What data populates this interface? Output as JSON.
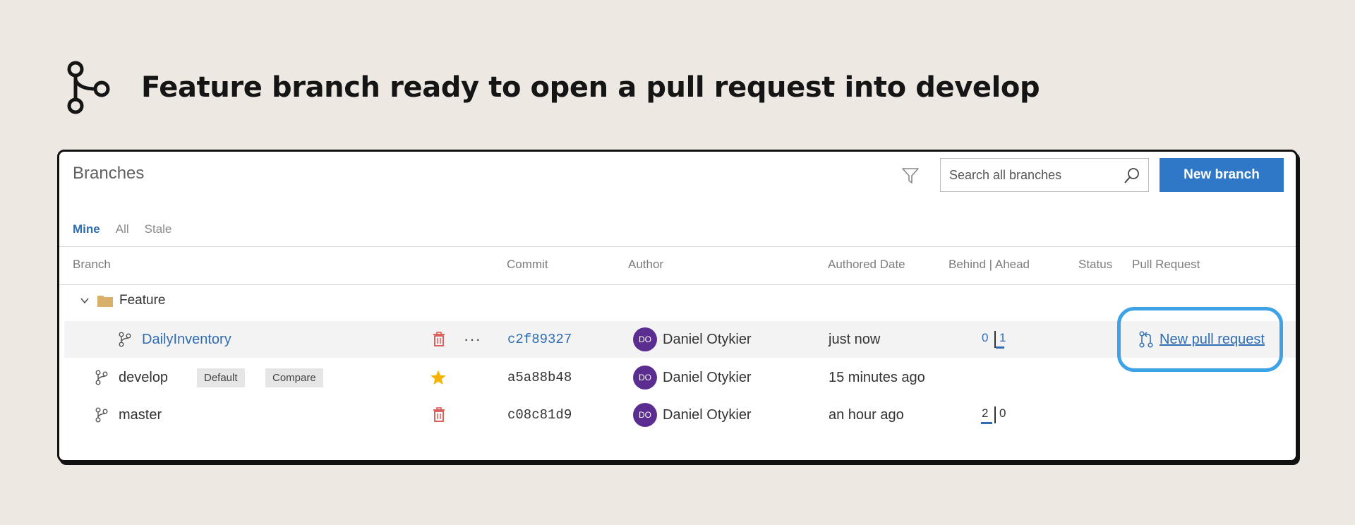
{
  "caption": {
    "title": "Feature branch ready to open a pull request into develop",
    "icon": "git-branch-icon"
  },
  "panel": {
    "title": "Branches",
    "search_placeholder": "Search all branches",
    "new_branch_label": "New branch",
    "tabs": [
      {
        "label": "Mine",
        "active": true
      },
      {
        "label": "All",
        "active": false
      },
      {
        "label": "Stale",
        "active": false
      }
    ],
    "columns": {
      "branch": "Branch",
      "commit": "Commit",
      "author": "Author",
      "authored_date": "Authored Date",
      "behind_ahead": "Behind | Ahead",
      "status": "Status",
      "pull_request": "Pull Request"
    },
    "group": {
      "label": "Feature",
      "expanded": true,
      "icon": "folder-icon"
    },
    "rows": [
      {
        "name": "DailyInventory",
        "commit": "c2f89327",
        "author_initials": "DO",
        "author": "Daniel Otykier",
        "date": "just now",
        "behind": "0",
        "ahead": "1",
        "behind_fraction": 0,
        "ahead_fraction": 1,
        "pull_request": "New pull request",
        "action_icon": "trash-icon",
        "highlighted": true
      },
      {
        "name": "develop",
        "badges": [
          "Default",
          "Compare"
        ],
        "commit": "a5a88b48",
        "author_initials": "DO",
        "author": "Daniel Otykier",
        "date": "15 minutes ago",
        "action_icon": "star-icon"
      },
      {
        "name": "master",
        "commit": "c08c81d9",
        "author_initials": "DO",
        "author": "Daniel Otykier",
        "date": "an hour ago",
        "behind": "2",
        "ahead": "0",
        "behind_fraction": 1,
        "ahead_fraction": 0,
        "action_icon": "trash-icon"
      }
    ]
  },
  "colors": {
    "accent": "#2f78c8",
    "link": "#2f6db3",
    "highlight_ring": "#3ea3e6",
    "avatar": "#5c2d91",
    "trash": "#d9534f",
    "star": "#f4b400",
    "background": "#ede8e1"
  }
}
